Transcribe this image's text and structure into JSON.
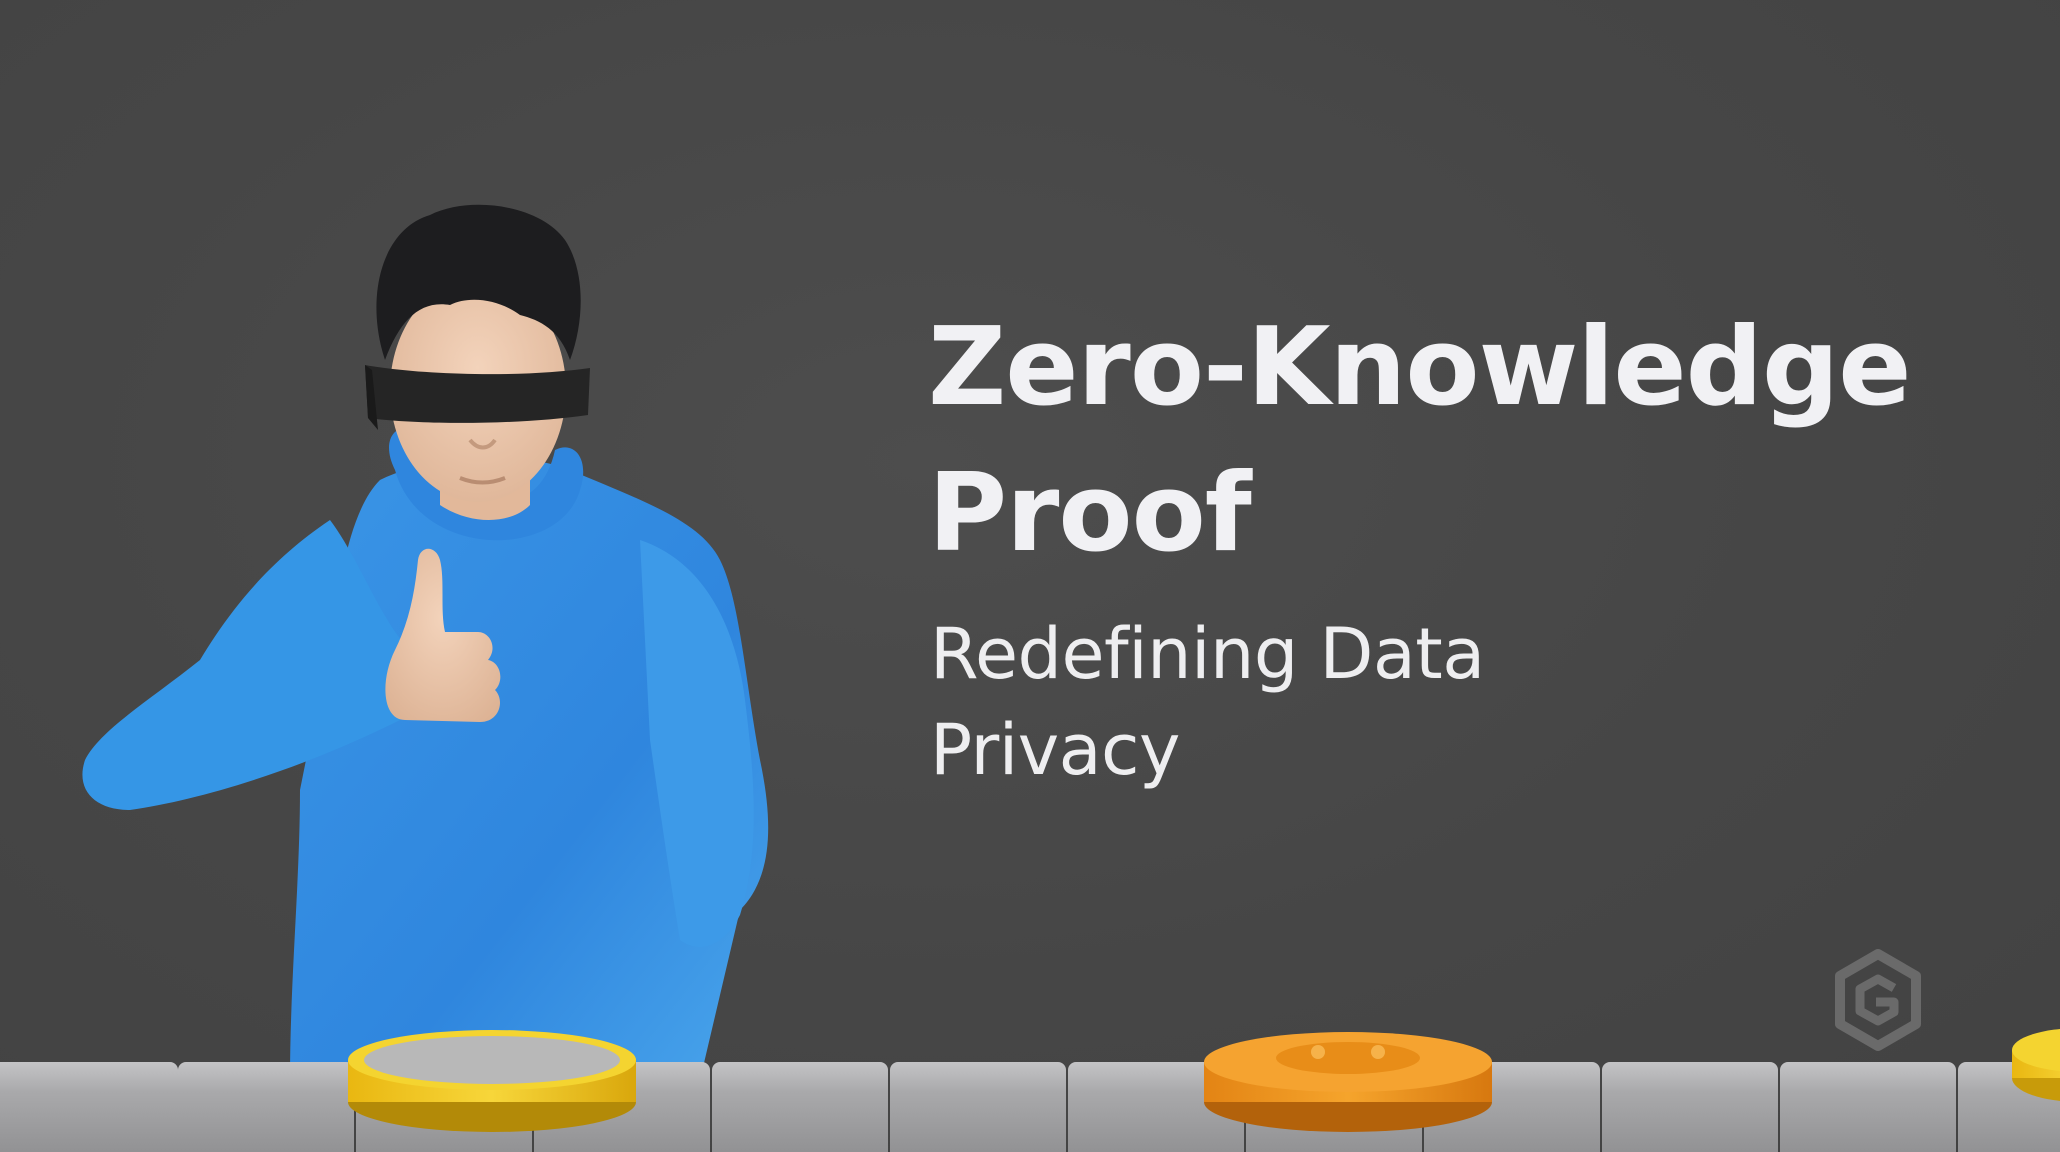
{
  "title": {
    "line1": "Zero-Knowledge",
    "line2": "Proof"
  },
  "subtitle": {
    "line1": "Redefining Data",
    "line2": "Privacy"
  },
  "colors": {
    "background": "#474747",
    "text": "#f1f1f4",
    "hoodie": "#3e9be8",
    "skin": "#ecc7ad",
    "hair": "#1f1f1f",
    "blindfold": "#262626",
    "tiles": "#a7a7a9",
    "gold_ring": "#f2c81a",
    "orange_coin": "#f0961f",
    "logo": "#6a6a6a"
  },
  "icons": {
    "logo": "hexagon-logo-icon",
    "figure": "blindfolded-person-illustration"
  }
}
